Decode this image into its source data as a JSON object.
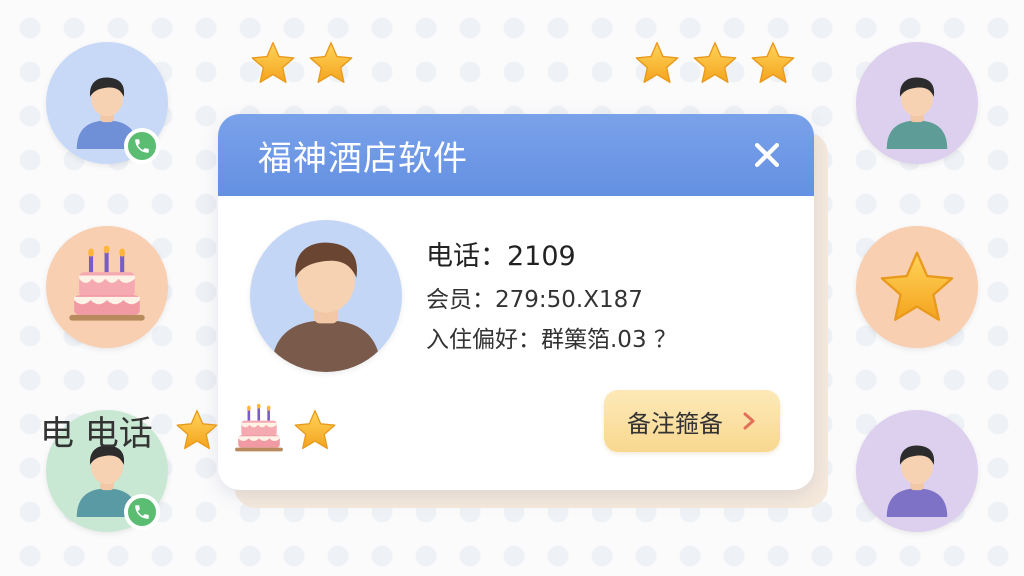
{
  "dialog": {
    "title": "福神酒店软件",
    "phone_line": "电话：2109",
    "member_line": "会员：279:50.X187",
    "preference_line": "入住偏好：群篥箔.03 ？",
    "phone_label": "电 电话",
    "note_button_label": "备注箍备"
  },
  "colors": {
    "header": "#6d98e6",
    "note_button": "#f9dc98",
    "star": "#f7b733",
    "phone_badge": "#5bbd72"
  },
  "icons": {
    "close": "close-icon",
    "chevron": "chevron-right-icon",
    "star": "star-icon",
    "cake": "birthday-cake-icon",
    "phone": "phone-icon"
  }
}
